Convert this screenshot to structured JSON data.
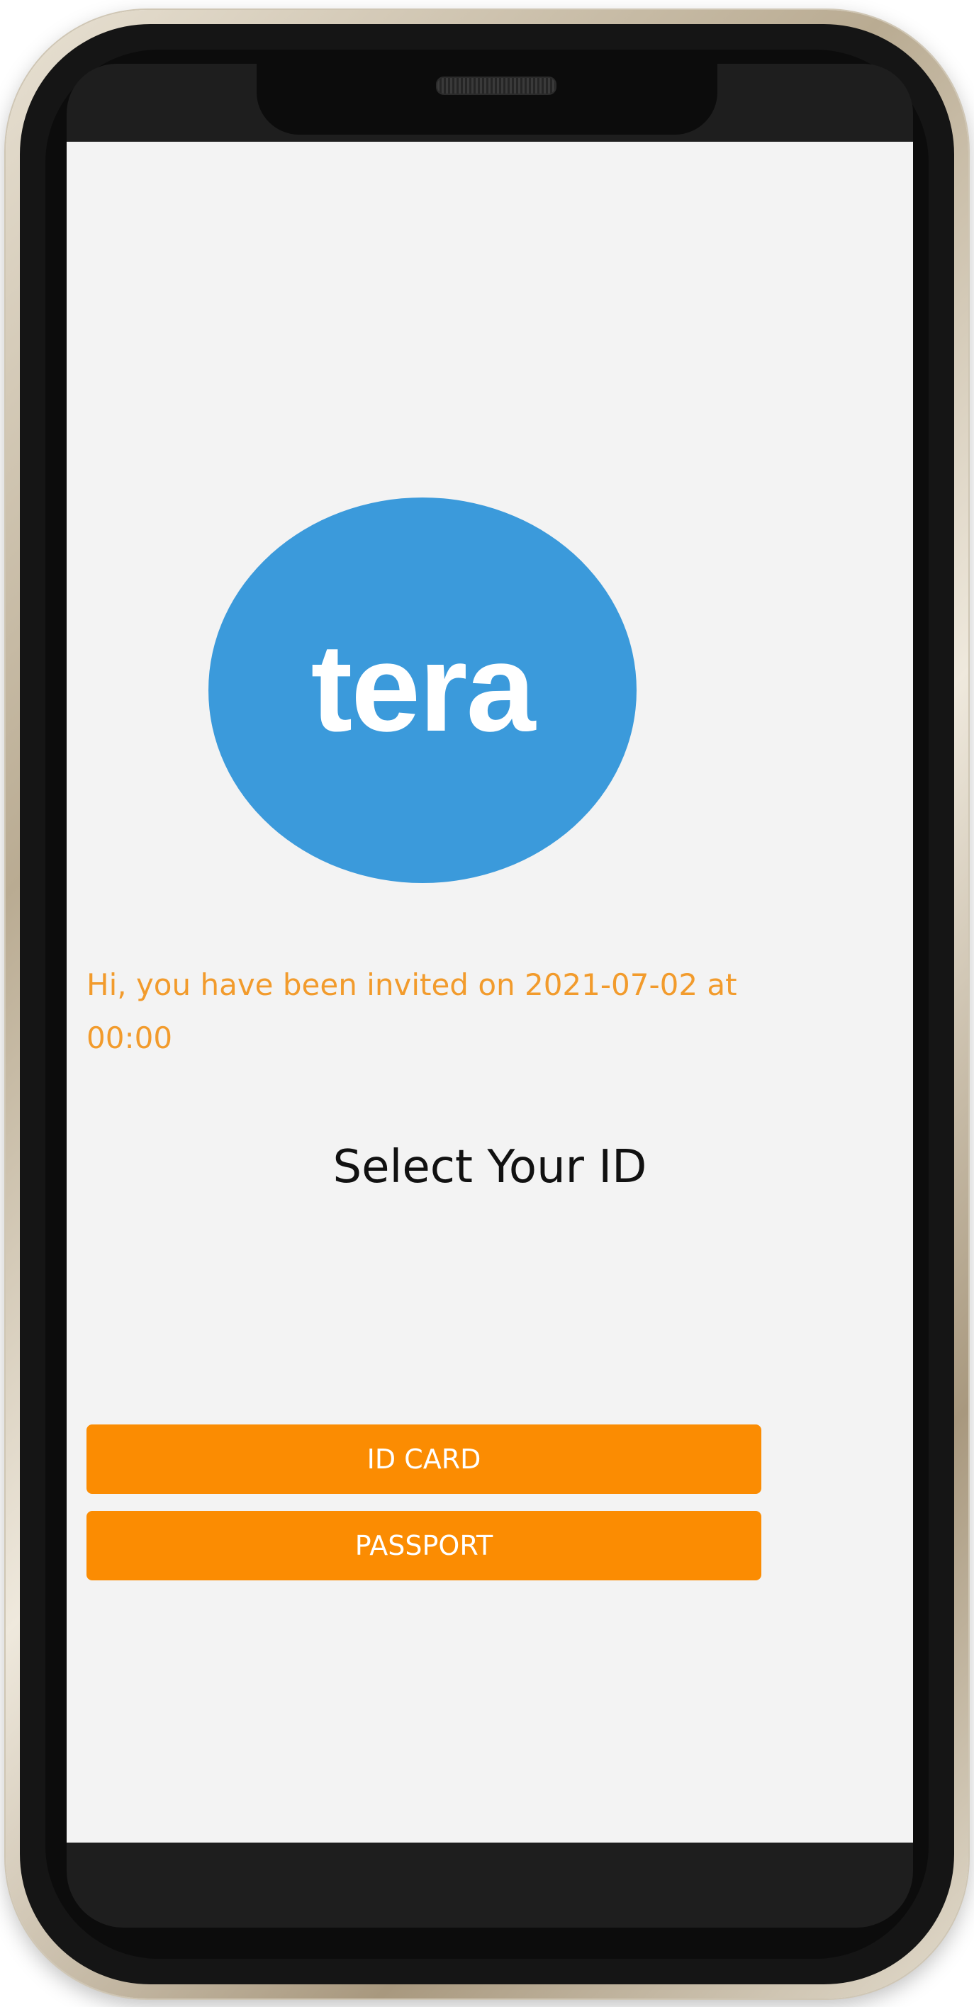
{
  "logo": {
    "text": "tera",
    "color": "#3b9adb"
  },
  "invite": {
    "message": "Hi, you have been invited on 2021-07-02 at 00:00"
  },
  "selection": {
    "title": "Select Your ID",
    "buttons": {
      "id_card": "ID CARD",
      "passport": "PASSPORT"
    }
  },
  "colors": {
    "accent": "#fb8c02",
    "invite_text": "#f29b2c",
    "background": "#f3f3f3"
  }
}
